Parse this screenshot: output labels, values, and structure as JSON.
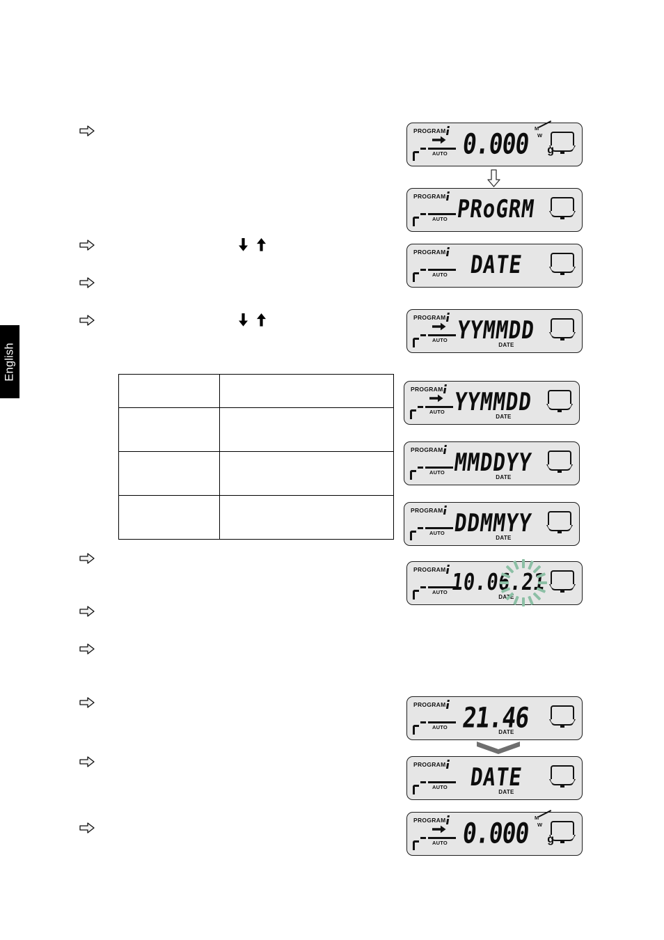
{
  "page": {
    "language_tab": "English",
    "bullet_icon": "hollow-right-arrow",
    "blank_step_text": ""
  },
  "steps": [
    {
      "id": "step-1",
      "bullet": "⇨",
      "text": ""
    },
    {
      "id": "step-2",
      "bullet": "⇨",
      "text": "",
      "keys": [
        "down-arrow-key",
        "up-arrow-key"
      ]
    },
    {
      "id": "step-3",
      "bullet": "⇨",
      "text": ""
    },
    {
      "id": "step-4",
      "bullet": "⇨",
      "text": "",
      "keys": [
        "down-arrow-key",
        "up-arrow-key"
      ]
    },
    {
      "id": "step-5",
      "bullet": "⇨",
      "text": ""
    },
    {
      "id": "step-6",
      "bullet": "⇨",
      "text": ""
    },
    {
      "id": "step-7",
      "bullet": "⇨",
      "text": ""
    },
    {
      "id": "step-8",
      "bullet": "⇨",
      "text": ""
    },
    {
      "id": "step-9",
      "bullet": "⇨",
      "text": ""
    },
    {
      "id": "step-10",
      "bullet": "⇨",
      "text": ""
    }
  ],
  "format_table": {
    "columns": [
      "",
      ""
    ],
    "rows": [
      {
        "format": "",
        "description": ""
      },
      {
        "format": "",
        "description": ""
      },
      {
        "format": "",
        "description": ""
      },
      {
        "format": "",
        "description": ""
      }
    ]
  },
  "connectors": {
    "down_arrow": "⇩",
    "double_chevron": "double-chevron-down"
  },
  "colors": {
    "lcd_background": "#e6e6e6",
    "lcd_border": "#1c1c1c",
    "segment": "#0d0d0d",
    "blink_ray": "#8cbfa5",
    "tab_background": "#000000"
  },
  "displays": [
    {
      "id": "display-zero-weight-top",
      "program_label": "PROGRAM",
      "auto_label": "AUTO",
      "readout": "0.000",
      "unit": "g",
      "date_label": "",
      "show_right_arrow": true,
      "show_mw": true,
      "show_pan": true,
      "blinking": false
    },
    {
      "id": "display-progrm",
      "program_label": "PROGRAM",
      "auto_label": "AUTO",
      "readout": "PRoGRM",
      "unit": "",
      "date_label": "",
      "show_right_arrow": false,
      "show_mw": false,
      "show_pan": true,
      "blinking": false
    },
    {
      "id": "display-date-menu",
      "program_label": "PROGRAM",
      "auto_label": "AUTO",
      "readout": "DATE",
      "unit": "",
      "date_label": "",
      "show_right_arrow": false,
      "show_mw": false,
      "show_pan": true,
      "blinking": false
    },
    {
      "id": "display-yymmdd-selected",
      "program_label": "PROGRAM",
      "auto_label": "AUTO",
      "readout": "YYMMDD",
      "unit": "",
      "date_label": "DATE",
      "show_right_arrow": true,
      "show_mw": false,
      "show_pan": true,
      "blinking": false
    },
    {
      "id": "display-format-yymmdd",
      "program_label": "PROGRAM",
      "auto_label": "AUTO",
      "readout": "YYMMDD",
      "unit": "",
      "date_label": "DATE",
      "show_right_arrow": true,
      "show_mw": false,
      "show_pan": true,
      "blinking": false
    },
    {
      "id": "display-format-mmddyy",
      "program_label": "PROGRAM",
      "auto_label": "AUTO",
      "readout": "MMDDYY",
      "unit": "",
      "date_label": "DATE",
      "show_right_arrow": false,
      "show_mw": false,
      "show_pan": true,
      "blinking": false
    },
    {
      "id": "display-format-ddmmyy",
      "program_label": "PROGRAM",
      "auto_label": "AUTO",
      "readout": "DDMMYY",
      "unit": "",
      "date_label": "DATE",
      "show_right_arrow": false,
      "show_mw": false,
      "show_pan": true,
      "blinking": false
    },
    {
      "id": "display-date-entry-blinking",
      "program_label": "PROGRAM",
      "auto_label": "AUTO",
      "readout": "10.06.21",
      "unit": "",
      "date_label": "DATE",
      "show_right_arrow": false,
      "show_mw": false,
      "show_pan": true,
      "blinking": true
    },
    {
      "id": "display-time-2146",
      "program_label": "PROGRAM",
      "auto_label": "AUTO",
      "readout": "21.46",
      "unit": "",
      "date_label": "DATE",
      "show_right_arrow": false,
      "show_mw": false,
      "show_pan": true,
      "blinking": false
    },
    {
      "id": "display-date-return",
      "program_label": "PROGRAM",
      "auto_label": "AUTO",
      "readout": "DATE",
      "unit": "",
      "date_label": "DATE",
      "show_right_arrow": false,
      "show_mw": false,
      "show_pan": true,
      "blinking": false
    },
    {
      "id": "display-zero-weight-bottom",
      "program_label": "PROGRAM",
      "auto_label": "AUTO",
      "readout": "0.000",
      "unit": "g",
      "date_label": "",
      "show_right_arrow": true,
      "show_mw": true,
      "show_pan": true,
      "blinking": false
    }
  ]
}
